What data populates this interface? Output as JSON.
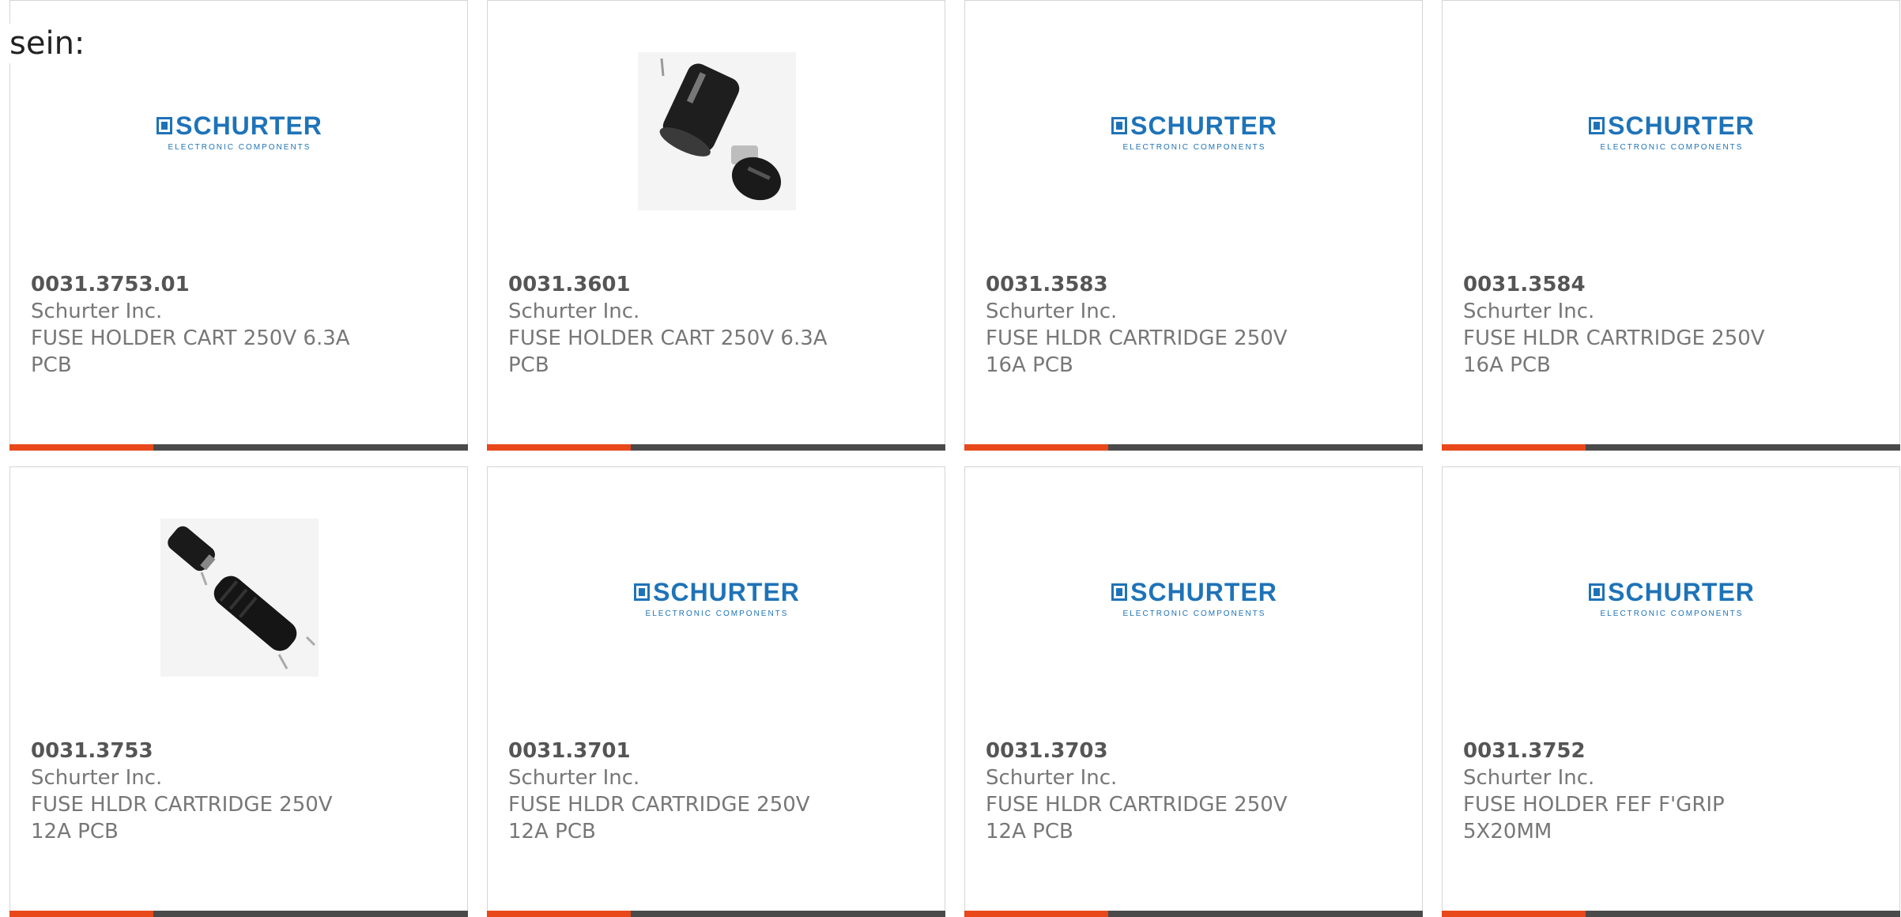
{
  "intro_text": "sein:",
  "brand_logo": {
    "name": "SCHURTER",
    "tagline": "ELECTRONIC COMPONENTS"
  },
  "colors": {
    "accent": "#e8481a",
    "bar": "#4a4a4a",
    "logo": "#1e73b8"
  },
  "products": [
    {
      "part_number": "0031.3753.01",
      "manufacturer": "Schurter Inc.",
      "description": "FUSE HOLDER CART 250V 6.3A PCB",
      "image": "schurter-logo"
    },
    {
      "part_number": "0031.3601",
      "manufacturer": "Schurter Inc.",
      "description": "FUSE HOLDER CART 250V 6.3A PCB",
      "image": "fuse-holder-photo-round"
    },
    {
      "part_number": "0031.3583",
      "manufacturer": "Schurter Inc.",
      "description": "FUSE HLDR CARTRIDGE 250V 16A PCB",
      "image": "schurter-logo"
    },
    {
      "part_number": "0031.3584",
      "manufacturer": "Schurter Inc.",
      "description": "FUSE HLDR CARTRIDGE 250V 16A PCB",
      "image": "schurter-logo"
    },
    {
      "part_number": "0031.3753",
      "manufacturer": "Schurter Inc.",
      "description": "FUSE HLDR CARTRIDGE 250V 12A PCB",
      "image": "fuse-holder-photo-pcb"
    },
    {
      "part_number": "0031.3701",
      "manufacturer": "Schurter Inc.",
      "description": "FUSE HLDR CARTRIDGE 250V 12A PCB",
      "image": "schurter-logo"
    },
    {
      "part_number": "0031.3703",
      "manufacturer": "Schurter Inc.",
      "description": "FUSE HLDR CARTRIDGE 250V 12A PCB",
      "image": "schurter-logo"
    },
    {
      "part_number": "0031.3752",
      "manufacturer": "Schurter Inc.",
      "description": "FUSE HOLDER FEF F'GRIP 5X20MM",
      "image": "schurter-logo"
    }
  ]
}
